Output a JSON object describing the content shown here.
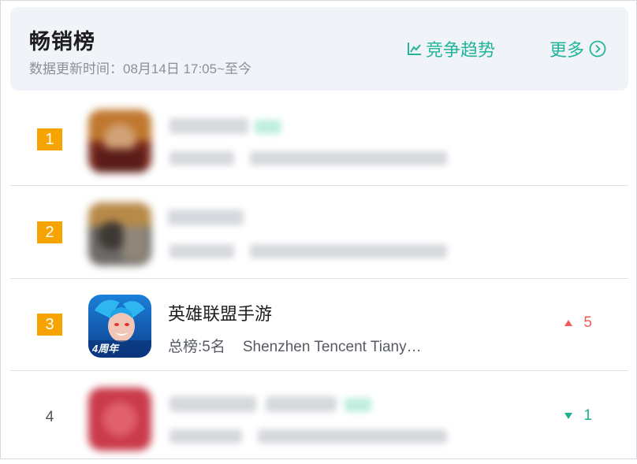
{
  "header": {
    "title": "畅销榜",
    "subtitle": "数据更新时间：08月14日 17:05~至今",
    "trend_label": "竞争趋势",
    "more_label": "更多"
  },
  "rows": [
    {
      "rank": "1",
      "name": "",
      "meta_rank": "",
      "developer": "",
      "change": "",
      "blurred": true,
      "icon": "game-hero-icon"
    },
    {
      "rank": "2",
      "name": "",
      "meta_rank": "",
      "developer": "",
      "change": "",
      "blurred": true,
      "icon": "game-warrior-icon"
    },
    {
      "rank": "3",
      "name": "英雄联盟手游",
      "meta_rank": "总榜:5名",
      "developer": "Shenzhen Tencent Tiany…",
      "change": "5",
      "direction": "up",
      "icon": "league-of-legends-mobile-icon",
      "icon_badge": "4周年"
    },
    {
      "rank": "4",
      "name": "",
      "meta_rank": "",
      "developer": "",
      "change": "1",
      "direction": "down",
      "blurred": true,
      "icon": "red-game-icon"
    }
  ],
  "colors": {
    "accent": "#22b59a",
    "rank_badge": "#f7a400",
    "up": "#f05a5a",
    "down": "#1fae8f",
    "header_bg": "#f0f3f7"
  }
}
